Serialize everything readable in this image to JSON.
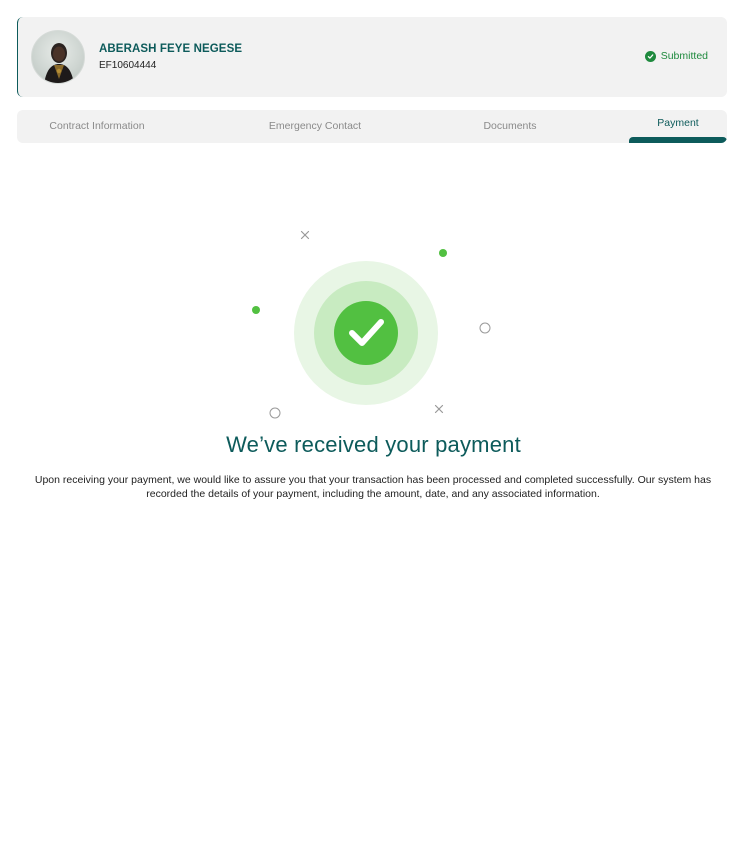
{
  "profile": {
    "name": "ABERASH FEYE NEGESE",
    "id": "EF10604444",
    "status": "Submitted"
  },
  "tabs": [
    {
      "label": "Contract Information",
      "active": false
    },
    {
      "label": "Emergency Contact",
      "active": false
    },
    {
      "label": "Documents",
      "active": false
    },
    {
      "label": "Payment",
      "active": true
    }
  ],
  "confirmation": {
    "title": "We’ve received your payment",
    "message": "Upon receiving your payment, we would like to assure you that your transaction has been processed and completed successfully. Our system has recorded the details of your payment, including the amount, date, and any associated information."
  },
  "colors": {
    "brand": "#0d5b5b",
    "success": "#52c041",
    "success_light": "#c8ebc1",
    "success_lighter": "#e8f6e5",
    "status_text": "#1f8a3e"
  },
  "icons": {
    "status": "check-circle-icon",
    "success": "check-icon"
  }
}
